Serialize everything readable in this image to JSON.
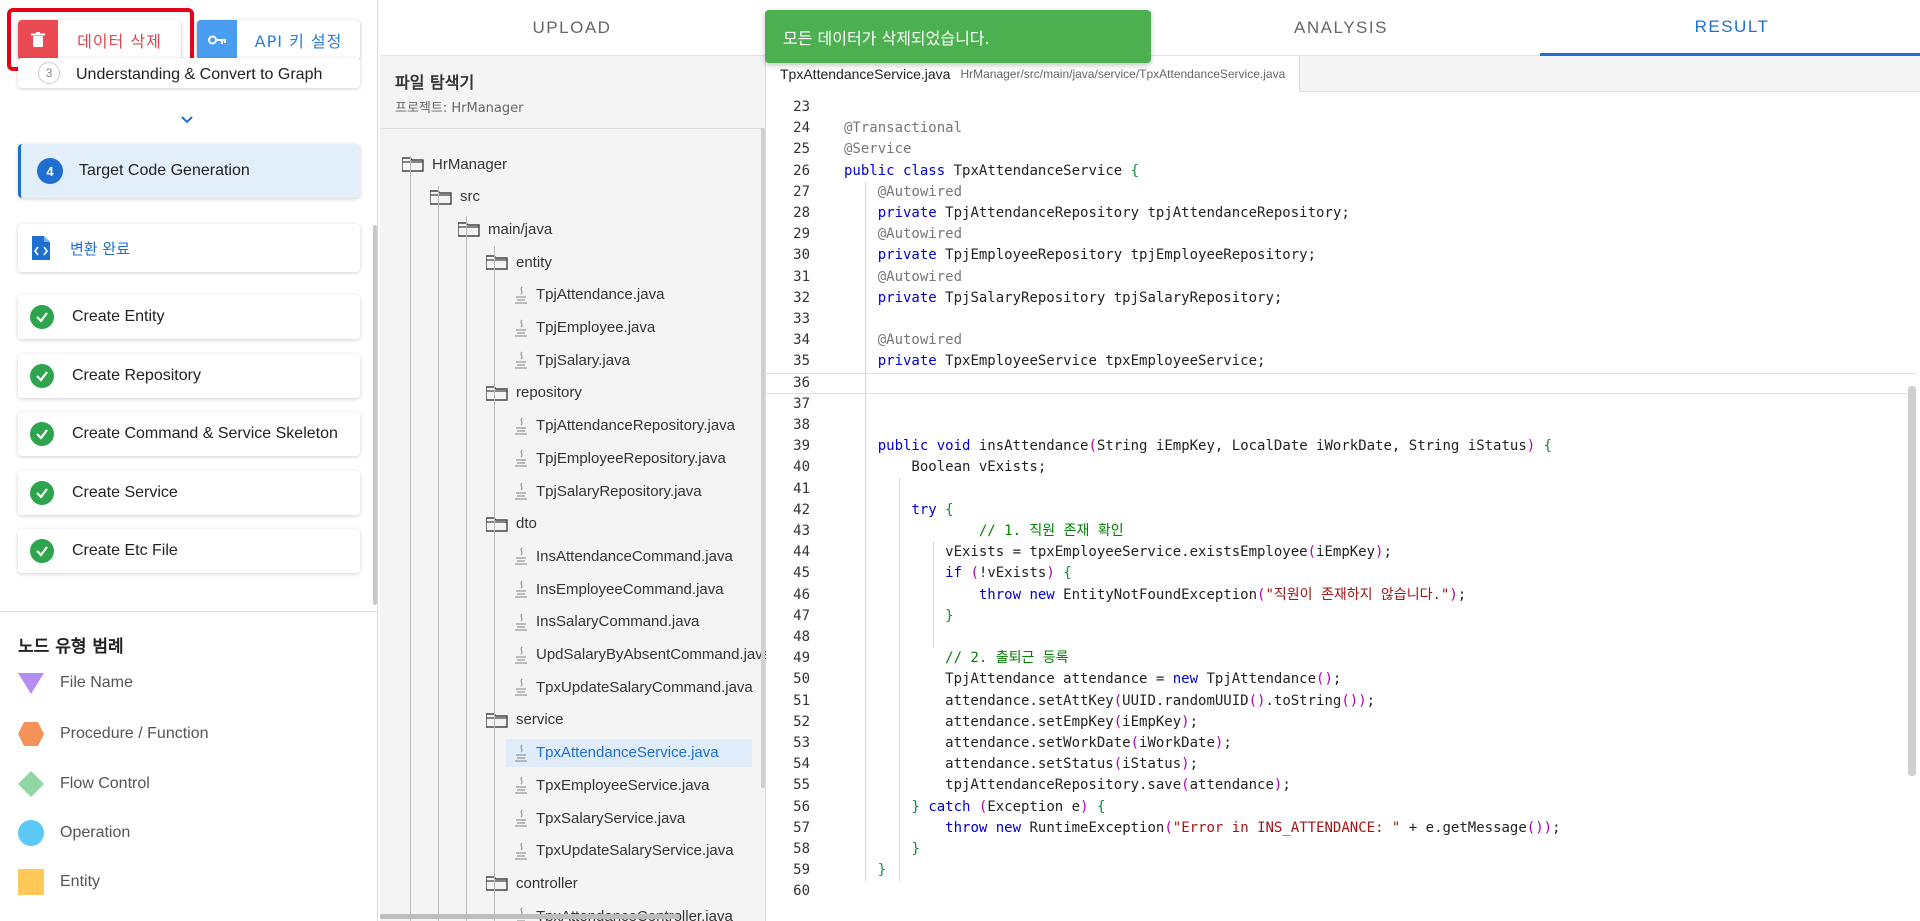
{
  "top_buttons": {
    "delete_label": "데이터 삭제",
    "api_label": "API 키 설정"
  },
  "steps": {
    "step3": {
      "number": "3",
      "label": "Understanding & Convert to Graph"
    },
    "step4": {
      "number": "4",
      "label": "Target Code Generation"
    }
  },
  "done_card": {
    "label": "변환 완료"
  },
  "tasks": [
    "Create Entity",
    "Create Repository",
    "Create Command & Service Skeleton",
    "Create Service",
    "Create Etc File"
  ],
  "legend": {
    "title": "노드 유형 범례",
    "items": [
      {
        "label": "File Name",
        "color": "#b48ef5"
      },
      {
        "label": "Procedure / Function",
        "color": "#f5925a"
      },
      {
        "label": "Flow Control",
        "color": "#8fd6a2"
      },
      {
        "label": "Operation",
        "color": "#5bc8f5"
      },
      {
        "label": "Entity",
        "color": "#ffc857"
      }
    ]
  },
  "tabs": [
    "UPLOAD",
    "",
    "ANALYSIS",
    "RESULT"
  ],
  "active_tab": "RESULT",
  "toast": {
    "message": "모든 데이터가 삭제되었습니다."
  },
  "explorer": {
    "title": "파일 탐색기",
    "project": "프로젝트: HrManager",
    "tree": [
      {
        "label": "HrManager",
        "type": "folder"
      },
      {
        "label": "src",
        "type": "folder"
      },
      {
        "label": "main/java",
        "type": "folder"
      },
      {
        "label": "entity",
        "type": "folder"
      },
      {
        "label": "TpjAttendance.java",
        "type": "file"
      },
      {
        "label": "TpjEmployee.java",
        "type": "file"
      },
      {
        "label": "TpjSalary.java",
        "type": "file"
      },
      {
        "label": "repository",
        "type": "folder"
      },
      {
        "label": "TpjAttendanceRepository.java",
        "type": "file"
      },
      {
        "label": "TpjEmployeeRepository.java",
        "type": "file"
      },
      {
        "label": "TpjSalaryRepository.java",
        "type": "file"
      },
      {
        "label": "dto",
        "type": "folder"
      },
      {
        "label": "InsAttendanceCommand.java",
        "type": "file"
      },
      {
        "label": "InsEmployeeCommand.java",
        "type": "file"
      },
      {
        "label": "InsSalaryCommand.java",
        "type": "file"
      },
      {
        "label": "UpdSalaryByAbsentCommand.java",
        "type": "file"
      },
      {
        "label": "TpxUpdateSalaryCommand.java",
        "type": "file"
      },
      {
        "label": "service",
        "type": "folder"
      },
      {
        "label": "TpxAttendanceService.java",
        "type": "file",
        "selected": true
      },
      {
        "label": "TpxEmployeeService.java",
        "type": "file"
      },
      {
        "label": "TpxSalaryService.java",
        "type": "file"
      },
      {
        "label": "TpxUpdateSalaryService.java",
        "type": "file"
      },
      {
        "label": "controller",
        "type": "folder"
      },
      {
        "label": "TpxAttendanceController.java",
        "type": "file"
      }
    ]
  },
  "editor": {
    "tab_name": "TpxAttendanceService.java",
    "tab_path": "HrManager/src/main/java/service/TpxAttendanceService.java",
    "current_line": "36",
    "lines": [
      {
        "n": "23",
        "t": ""
      },
      {
        "n": "24",
        "t": "@Transactional"
      },
      {
        "n": "25",
        "t": "@Service"
      },
      {
        "n": "26",
        "t": "public class TpxAttendanceService {"
      },
      {
        "n": "27",
        "t": "    @Autowired"
      },
      {
        "n": "28",
        "t": "    private TpjAttendanceRepository tpjAttendanceRepository;"
      },
      {
        "n": "29",
        "t": "    @Autowired"
      },
      {
        "n": "30",
        "t": "    private TpjEmployeeRepository tpjEmployeeRepository;"
      },
      {
        "n": "31",
        "t": "    @Autowired"
      },
      {
        "n": "32",
        "t": "    private TpjSalaryRepository tpjSalaryRepository;"
      },
      {
        "n": "33",
        "t": ""
      },
      {
        "n": "34",
        "t": "    @Autowired"
      },
      {
        "n": "35",
        "t": "    private TpxEmployeeService tpxEmployeeService;"
      },
      {
        "n": "36",
        "t": ""
      },
      {
        "n": "37",
        "t": ""
      },
      {
        "n": "38",
        "t": ""
      },
      {
        "n": "39",
        "t": "    public void insAttendance(String iEmpKey, LocalDate iWorkDate, String iStatus) {"
      },
      {
        "n": "40",
        "t": "        Boolean vExists;"
      },
      {
        "n": "41",
        "t": ""
      },
      {
        "n": "42",
        "t": "        try {"
      },
      {
        "n": "43",
        "t": "                // 1. 직원 존재 확인"
      },
      {
        "n": "44",
        "t": "            vExists = tpxEmployeeService.existsEmployee(iEmpKey);"
      },
      {
        "n": "45",
        "t": "            if (!vExists) {"
      },
      {
        "n": "46",
        "t": "                throw new EntityNotFoundException(\"직원이 존재하지 않습니다.\");"
      },
      {
        "n": "47",
        "t": "            }"
      },
      {
        "n": "48",
        "t": ""
      },
      {
        "n": "49",
        "t": "            // 2. 출퇴근 등록"
      },
      {
        "n": "50",
        "t": "            TpjAttendance attendance = new TpjAttendance();"
      },
      {
        "n": "51",
        "t": "            attendance.setAttKey(UUID.randomUUID().toString());"
      },
      {
        "n": "52",
        "t": "            attendance.setEmpKey(iEmpKey);"
      },
      {
        "n": "53",
        "t": "            attendance.setWorkDate(iWorkDate);"
      },
      {
        "n": "54",
        "t": "            attendance.setStatus(iStatus);"
      },
      {
        "n": "55",
        "t": "            tpjAttendanceRepository.save(attendance);"
      },
      {
        "n": "56",
        "t": "        } catch (Exception e) {"
      },
      {
        "n": "57",
        "t": "            throw new RuntimeException(\"Error in INS_ATTENDANCE: \" + e.getMessage());"
      },
      {
        "n": "58",
        "t": "        }"
      },
      {
        "n": "59",
        "t": "    }"
      },
      {
        "n": "60",
        "t": ""
      }
    ]
  }
}
